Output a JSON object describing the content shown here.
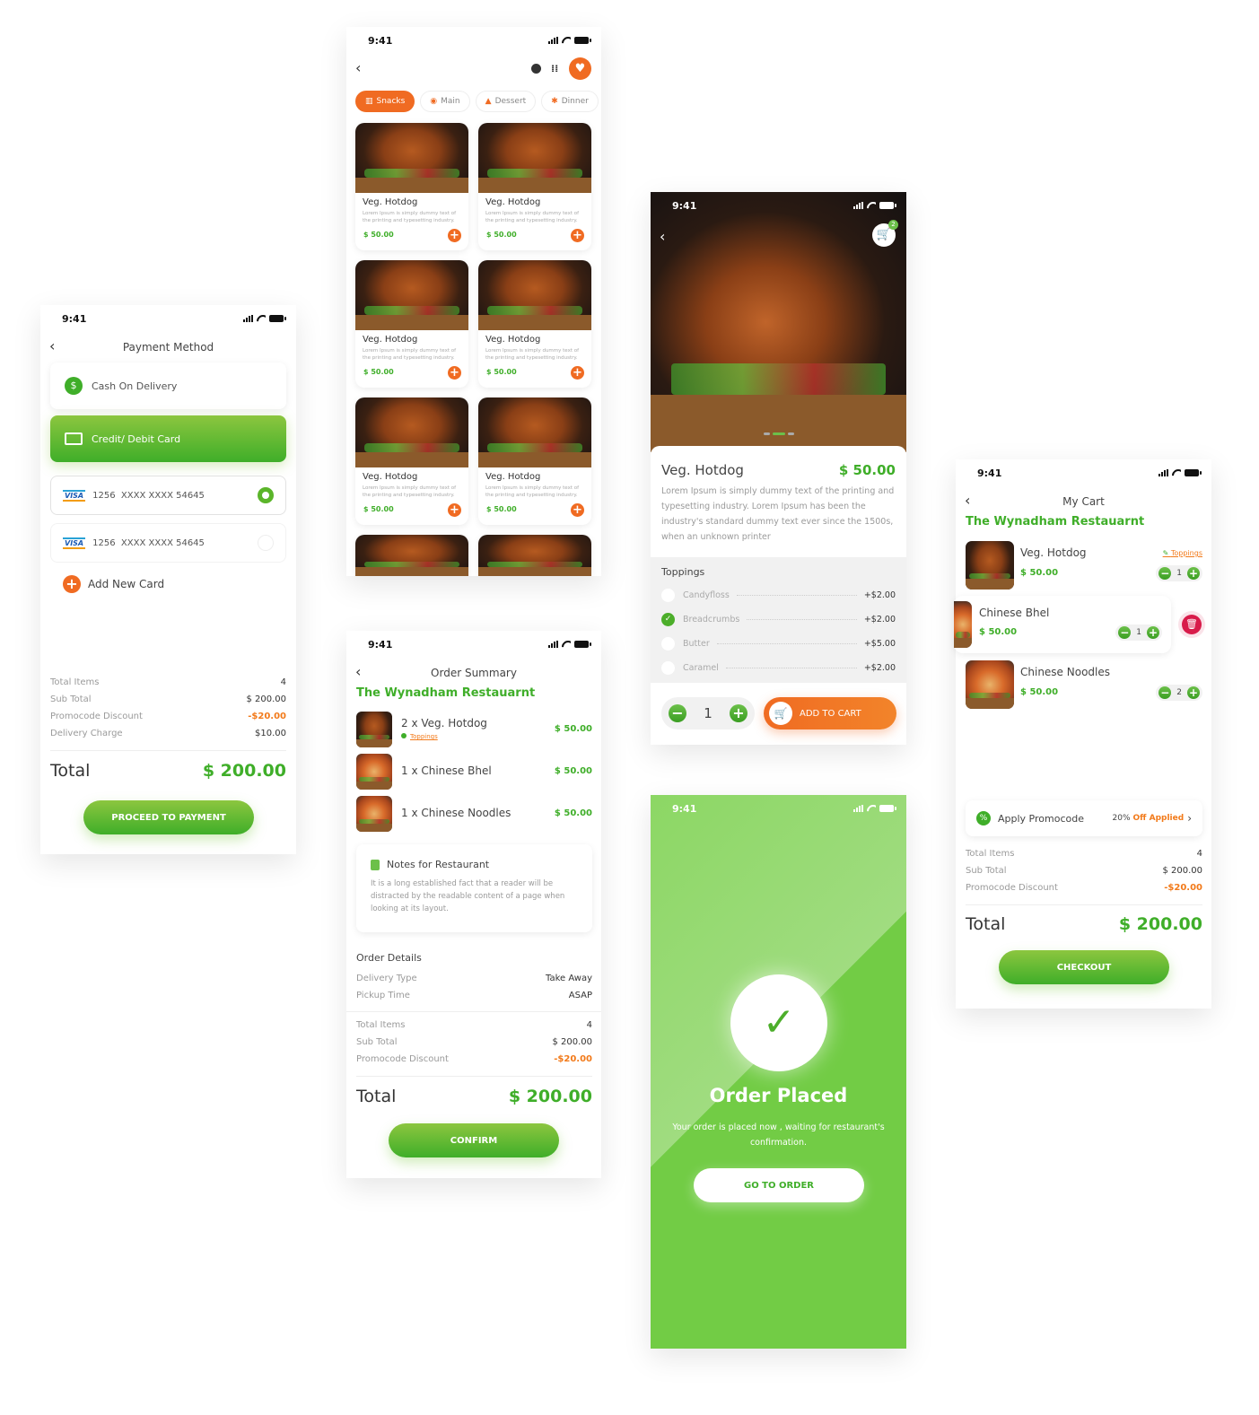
{
  "status_time": "9:41",
  "colors": {
    "green": "#3fae29",
    "orange": "#f06b22",
    "discount": "#f27a1a",
    "delete": "#d81b4a"
  },
  "menu": {
    "categories": [
      {
        "label": "Snacks",
        "icon": "popcorn-icon",
        "active": true
      },
      {
        "label": "Main",
        "icon": "plate-icon",
        "active": false
      },
      {
        "label": "Dessert",
        "icon": "cake-icon",
        "active": false
      },
      {
        "label": "Dinner",
        "icon": "dinner-icon",
        "active": false
      }
    ],
    "items": [
      {
        "name": "Veg. Hotdog",
        "desc": "Lorem Ipsum is simply dummy text of the printing and typesetting industry.",
        "price": "$ 50.00"
      },
      {
        "name": "Veg. Hotdog",
        "desc": "Lorem Ipsum is simply dummy text of the printing and typesetting industry.",
        "price": "$ 50.00"
      },
      {
        "name": "Veg. Hotdog",
        "desc": "Lorem Ipsum is simply dummy text of the printing and typesetting industry.",
        "price": "$ 50.00"
      },
      {
        "name": "Veg. Hotdog",
        "desc": "Lorem Ipsum is simply dummy text of the printing and typesetting industry.",
        "price": "$ 50.00"
      },
      {
        "name": "Veg. Hotdog",
        "desc": "Lorem Ipsum is simply dummy text of the printing and typesetting industry.",
        "price": "$ 50.00"
      },
      {
        "name": "Veg. Hotdog",
        "desc": "Lorem Ipsum is simply dummy text of the printing and typesetting industry.",
        "price": "$ 50.00"
      }
    ]
  },
  "payment": {
    "title": "Payment Method",
    "methods": [
      {
        "label": "Cash On Delivery",
        "selected": false
      },
      {
        "label": "Credit/ Debit Card",
        "selected": true
      }
    ],
    "cards": [
      {
        "brand": "VISA",
        "number": "1256  XXXX XXXX 54645",
        "selected": true
      },
      {
        "brand": "VISA",
        "number": "1256  XXXX XXXX 54645",
        "selected": false
      }
    ],
    "add_card": "Add New Card",
    "summary": [
      {
        "label": "Total Items",
        "value": "4"
      },
      {
        "label": "Sub Total",
        "value": "$ 200.00"
      },
      {
        "label": "Promocode Discount",
        "value": "-$20.00"
      },
      {
        "label": "Delivery Charge",
        "value": "$10.00"
      }
    ],
    "total_label": "Total",
    "total_value": "$ 200.00",
    "button": "PROCEED TO PAYMENT"
  },
  "detail": {
    "cart_count": "2",
    "name": "Veg. Hotdog",
    "price": "$ 50.00",
    "desc": "Lorem Ipsum is simply dummy text of the printing and typesetting industry. Lorem Ipsum has been the industry's standard dummy text ever since the 1500s, when an unknown printer",
    "toppings_title": "Toppings",
    "toppings": [
      {
        "name": "Candyfloss",
        "price": "+$2.00",
        "checked": false
      },
      {
        "name": "Breadcrumbs",
        "price": "+$2.00",
        "checked": true
      },
      {
        "name": "Butter",
        "price": "+$5.00",
        "checked": false
      },
      {
        "name": "Caramel",
        "price": "+$2.00",
        "checked": false
      }
    ],
    "quantity": "1",
    "add_to_cart": "ADD TO CART"
  },
  "order_summary": {
    "title": "Order Summary",
    "restaurant": "The Wynadham Restauarnt",
    "items": [
      {
        "name": "2 x Veg. Hotdog",
        "price": "$ 50.00",
        "toppings": "Toppings"
      },
      {
        "name": "1 x Chinese Bhel",
        "price": "$ 50.00"
      },
      {
        "name": "1 x Chinese Noodles",
        "price": "$ 50.00"
      }
    ],
    "notes_title": "Notes for Restaurant",
    "notes_text": "It is a long established fact that a reader will be distracted by the readable content of a page when looking at its layout.",
    "details_title": "Order Details",
    "details": [
      {
        "label": "Delivery Type",
        "value": "Take Away"
      },
      {
        "label": "Pickup Time",
        "value": "ASAP"
      }
    ],
    "summary": [
      {
        "label": "Total Items",
        "value": "4"
      },
      {
        "label": "Sub Total",
        "value": "$ 200.00"
      },
      {
        "label": "Promocode Discount",
        "value": "-$20.00"
      }
    ],
    "total_label": "Total",
    "total_value": "$ 200.00",
    "button": "CONFIRM"
  },
  "placed": {
    "title": "Order Placed",
    "message": "Your order is placed now , waiting for restaurant's confirmation.",
    "button": "GO TO ORDER"
  },
  "cart": {
    "title": "My Cart",
    "restaurant": "The Wynadham Restauarnt",
    "items": [
      {
        "name": "Veg. Hotdog",
        "price": "$ 50.00",
        "qty": "1",
        "toppings": "Toppings"
      },
      {
        "name": "Chinese Bhel",
        "price": "$ 50.00",
        "qty": "1"
      },
      {
        "name": "Chinese Noodles",
        "price": "$ 50.00",
        "qty": "2"
      }
    ],
    "promo_label": "Apply Promocode",
    "promo_pct": "20%",
    "promo_applied": "Off Applied",
    "summary": [
      {
        "label": "Total Items",
        "value": "4"
      },
      {
        "label": "Sub Total",
        "value": "$ 200.00"
      },
      {
        "label": "Promocode Discount",
        "value": "-$20.00"
      }
    ],
    "total_label": "Total",
    "total_value": "$ 200.00",
    "button": "CHECKOUT"
  }
}
